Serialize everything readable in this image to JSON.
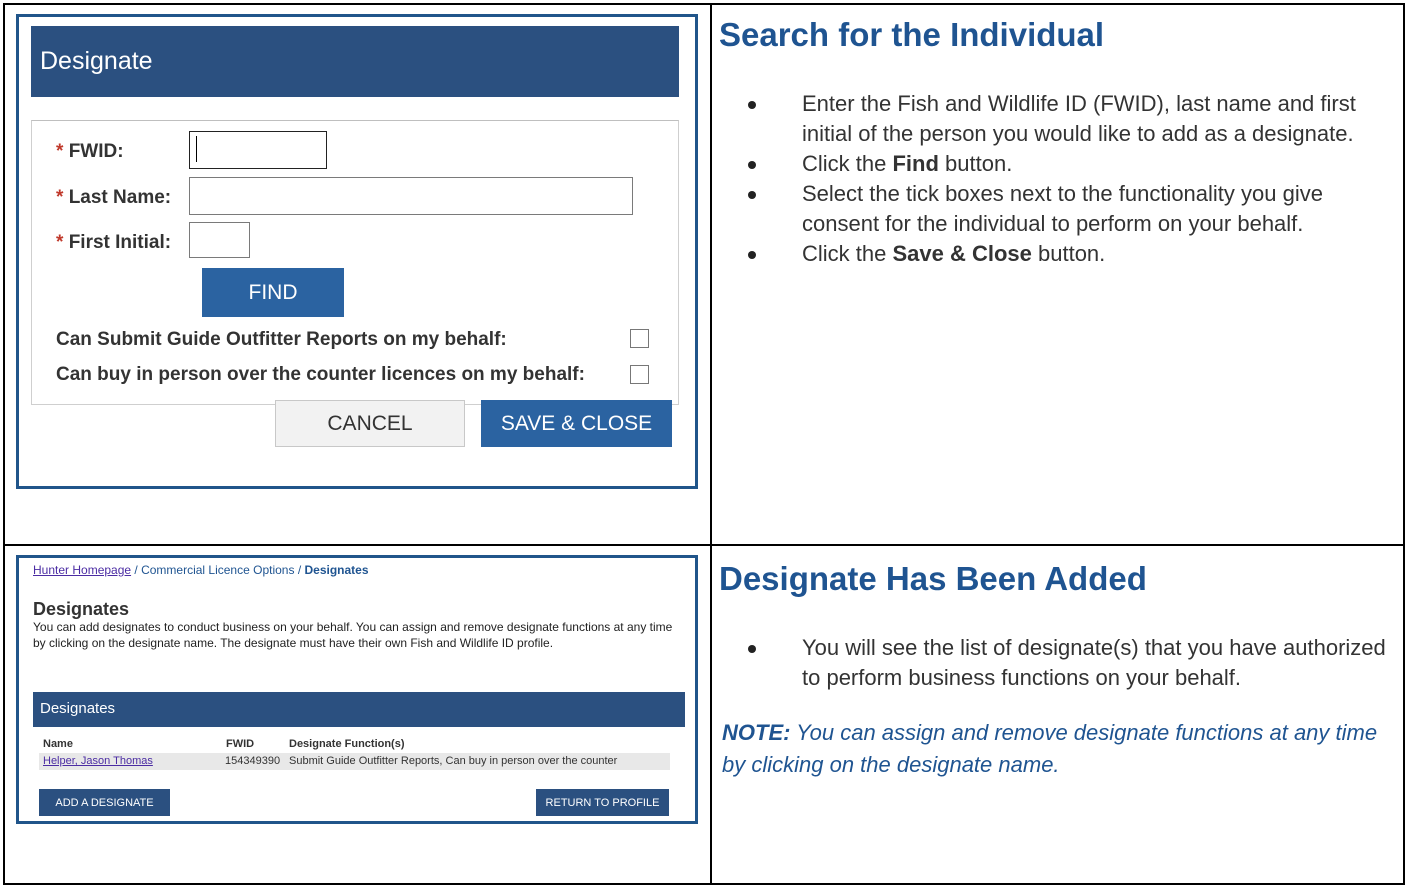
{
  "section1": {
    "heading": "Search for the Individual",
    "bullets": [
      {
        "text": "Enter the Fish and Wildlife ID (FWID), last name and first initial of the person you would like to add as a designate."
      },
      {
        "pre": "Click the ",
        "bold": "Find",
        "post": " button."
      },
      {
        "text": "Select the tick boxes next to the functionality you give consent for the individual to perform on your behalf."
      },
      {
        "pre": "Click the ",
        "bold": "Save & Close",
        "post": " button."
      }
    ]
  },
  "dialog": {
    "title": "Designate",
    "required_mark": "*",
    "fwid_label": "FWID:",
    "lastname_label": "Last Name:",
    "initial_label": "First Initial:",
    "find_button": "FIND",
    "checkbox1_label": "Can Submit Guide Outfitter Reports on my behalf:",
    "checkbox2_label": "Can buy in person over the counter licences on my behalf:",
    "checkbox1_checked": false,
    "checkbox2_checked": false,
    "cancel_button": "CANCEL",
    "save_button": "SAVE & CLOSE"
  },
  "section2": {
    "heading": "Designate Has Been Added",
    "bullets": [
      {
        "text": "You will see the list of designate(s) that you have authorized to perform business functions on your behalf."
      }
    ],
    "note_label": "NOTE:",
    "note_text": " You can assign and remove designate functions at any time by clicking on the designate name."
  },
  "designates_page": {
    "breadcrumb": {
      "link": "Hunter Homepage",
      "sep1": " / ",
      "middle": "Commercial Licence Options",
      "sep2": " / ",
      "current": "Designates"
    },
    "title": "Designates",
    "description": "You can add designates to conduct business on your behalf. You can assign and remove designate functions at any time by clicking on the designate name. The designate must have their own Fish and Wildlife ID profile.",
    "panel_title": "Designates",
    "columns": [
      "Name",
      "FWID",
      "Designate Function(s)"
    ],
    "rows": [
      {
        "name": "Helper, Jason Thomas",
        "fwid": "154349390",
        "functions": "Submit Guide Outfitter Reports, Can buy in person over the counter"
      }
    ],
    "add_button": "ADD A DESIGNATE",
    "return_button": "RETURN TO PROFILE"
  },
  "colors": {
    "heading_blue": "#1f5491",
    "header_navy": "#2b5080",
    "button_blue": "#2b63a1",
    "required_red": "#c0392b"
  }
}
